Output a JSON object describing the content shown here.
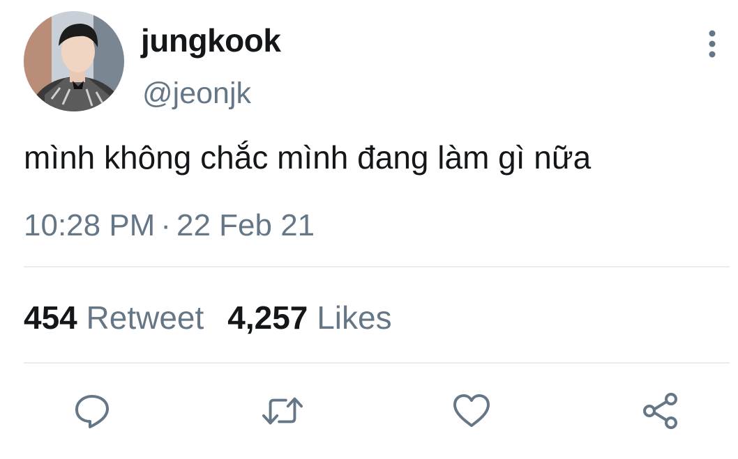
{
  "user": {
    "display_name": "jungkook",
    "handle": "@jeonjk"
  },
  "tweet": {
    "text": "mình không chắc mình đang làm gì nữa",
    "time": "10:28 PM",
    "separator": "·",
    "date": "22 Feb 21"
  },
  "stats": {
    "retweets": "454",
    "retweet_label": "Retweet",
    "likes": "4,257",
    "likes_label": "Likes"
  },
  "icons": {
    "more": "more-vertical-icon",
    "reply": "reply-icon",
    "retweet": "retweet-icon",
    "like": "heart-icon",
    "share": "share-icon"
  },
  "colors": {
    "text_primary": "#14171a",
    "text_secondary": "#657786",
    "divider": "#e6ecf0",
    "icon": "#657786"
  }
}
